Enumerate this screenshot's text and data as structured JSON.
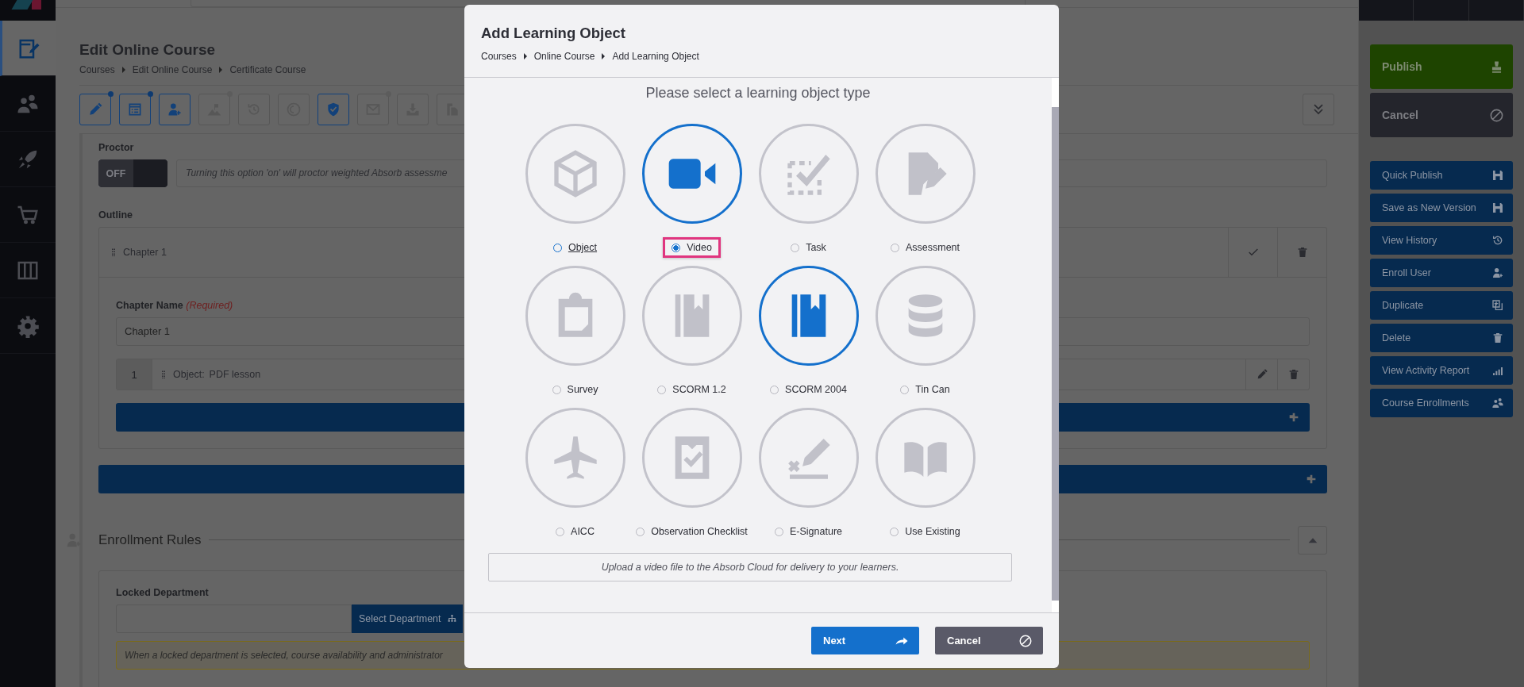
{
  "nav": [
    {
      "active": true
    },
    {
      "active": false
    },
    {
      "active": false
    },
    {
      "active": false
    },
    {
      "active": false
    },
    {
      "active": false
    }
  ],
  "page": {
    "title": "Edit Online Course",
    "breadcrumb": [
      "Courses",
      "Edit Online Course",
      "Certificate Course"
    ]
  },
  "toolbar": [
    {
      "active": true,
      "dot": true
    },
    {
      "active": true,
      "dot": true
    },
    {
      "active": true,
      "dot": false
    },
    {
      "active": false,
      "dot": true
    },
    {
      "active": false,
      "dot": false
    },
    {
      "active": false,
      "dot": false
    },
    {
      "active": true,
      "dot": false
    },
    {
      "active": false,
      "dot": true
    },
    {
      "active": false,
      "dot": false
    },
    {
      "active": false,
      "dot": false
    }
  ],
  "proctor": {
    "label": "Proctor",
    "toggle": {
      "on": false,
      "label": "OFF"
    },
    "hint": "Turning this option 'on' will proctor weighted Absorb assessme"
  },
  "outline": {
    "label": "Outline",
    "chapter": {
      "title": "Chapter 1",
      "name_label": "Chapter Name",
      "required": "(Required)",
      "name_value": "Chapter 1",
      "objects": [
        {
          "number": "1",
          "label": "Object:",
          "name": "PDF lesson"
        }
      ]
    }
  },
  "enrollment_rules": {
    "title": "Enrollment Rules",
    "expanded": true,
    "locked_department": {
      "label": "Locked Department",
      "button": "Select Department",
      "warning": "When a locked department is selected, course availability and administrator"
    }
  },
  "actions": [
    {
      "kind": "publish",
      "label": "Publish"
    },
    {
      "kind": "cancel",
      "label": "Cancel"
    },
    {
      "kind": "action",
      "label": "Quick Publish"
    },
    {
      "kind": "action",
      "label": "Save as New Version"
    },
    {
      "kind": "action",
      "label": "View History"
    },
    {
      "kind": "action",
      "label": "Enroll User"
    },
    {
      "kind": "action",
      "label": "Duplicate"
    },
    {
      "kind": "action",
      "label": "Delete"
    },
    {
      "kind": "action",
      "label": "View Activity Report"
    },
    {
      "kind": "action",
      "label": "Course Enrollments"
    }
  ],
  "modal": {
    "title": "Add Learning Object",
    "breadcrumb": [
      "Courses",
      "Online Course",
      "Add Learning Object"
    ],
    "prompt": "Please select a learning object type",
    "types": [
      {
        "label": "Object",
        "selected": false,
        "highlighted": false,
        "focused": true,
        "callout": false
      },
      {
        "label": "Video",
        "selected": true,
        "highlighted": true,
        "focused": false,
        "callout": true
      },
      {
        "label": "Task",
        "selected": false,
        "highlighted": false,
        "focused": false,
        "callout": false
      },
      {
        "label": "Assessment",
        "selected": false,
        "highlighted": false,
        "focused": false,
        "callout": false
      },
      {
        "label": "Survey",
        "selected": false,
        "highlighted": false,
        "focused": false,
        "callout": false
      },
      {
        "label": "SCORM 1.2",
        "selected": false,
        "highlighted": false,
        "focused": false,
        "callout": false
      },
      {
        "label": "SCORM 2004",
        "selected": false,
        "highlighted": true,
        "focused": false,
        "callout": false
      },
      {
        "label": "Tin Can",
        "selected": false,
        "highlighted": false,
        "focused": false,
        "callout": false
      },
      {
        "label": "AICC",
        "selected": false,
        "highlighted": false,
        "focused": false,
        "callout": false
      },
      {
        "label": "Observation Checklist",
        "selected": false,
        "highlighted": false,
        "focused": false,
        "callout": false
      },
      {
        "label": "E-Signature",
        "selected": false,
        "highlighted": false,
        "focused": false,
        "callout": false
      },
      {
        "label": "Use Existing",
        "selected": false,
        "highlighted": false,
        "focused": false,
        "callout": false
      }
    ],
    "description": "Upload a video file to the Absorb Cloud for delivery to your learners.",
    "buttons": [
      {
        "kind": "primary",
        "label": "Next"
      },
      {
        "kind": "secondary",
        "label": "Cancel"
      }
    ]
  }
}
